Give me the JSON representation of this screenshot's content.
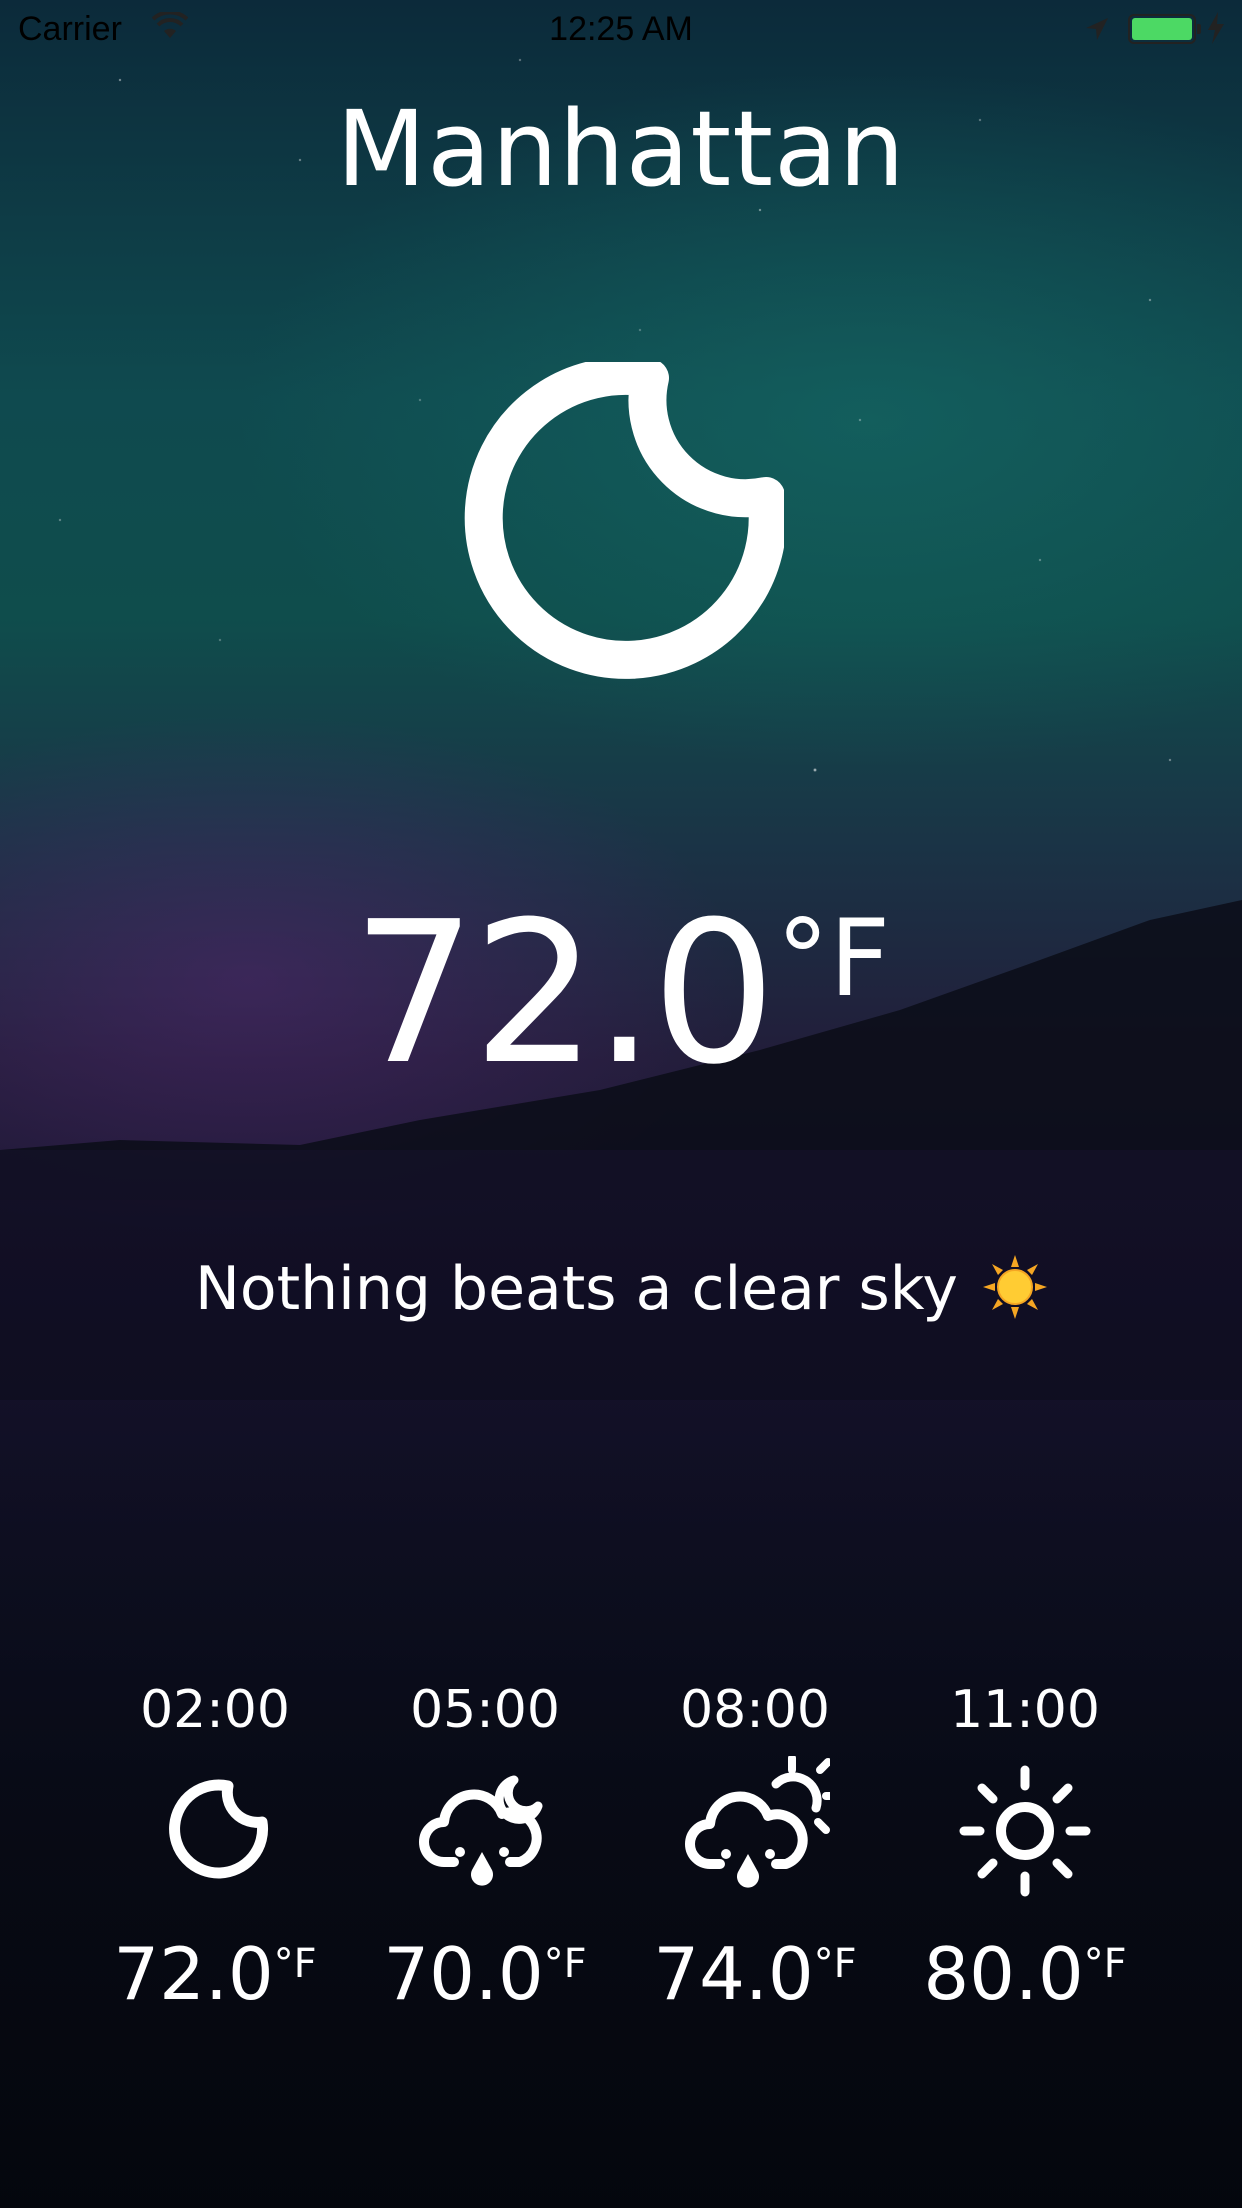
{
  "status_bar": {
    "carrier": "Carrier",
    "time": "12:25 AM",
    "battery_color": "#4cd964"
  },
  "weather": {
    "city": "Manhattan",
    "current_icon": "moon-icon",
    "temperature": "72.0",
    "unit": "°F",
    "message": "Nothing beats a clear sky",
    "message_emoji": "sun-emoji-icon"
  },
  "forecast": [
    {
      "time": "02:00",
      "icon": "moon-icon",
      "temperature": "72.0",
      "unit": "°F"
    },
    {
      "time": "05:00",
      "icon": "cloud-moon-rain-icon",
      "temperature": "70.0",
      "unit": "°F"
    },
    {
      "time": "08:00",
      "icon": "cloud-sun-rain-icon",
      "temperature": "74.0",
      "unit": "°F"
    },
    {
      "time": "11:00",
      "icon": "sun-icon",
      "temperature": "80.0",
      "unit": "°F"
    }
  ]
}
